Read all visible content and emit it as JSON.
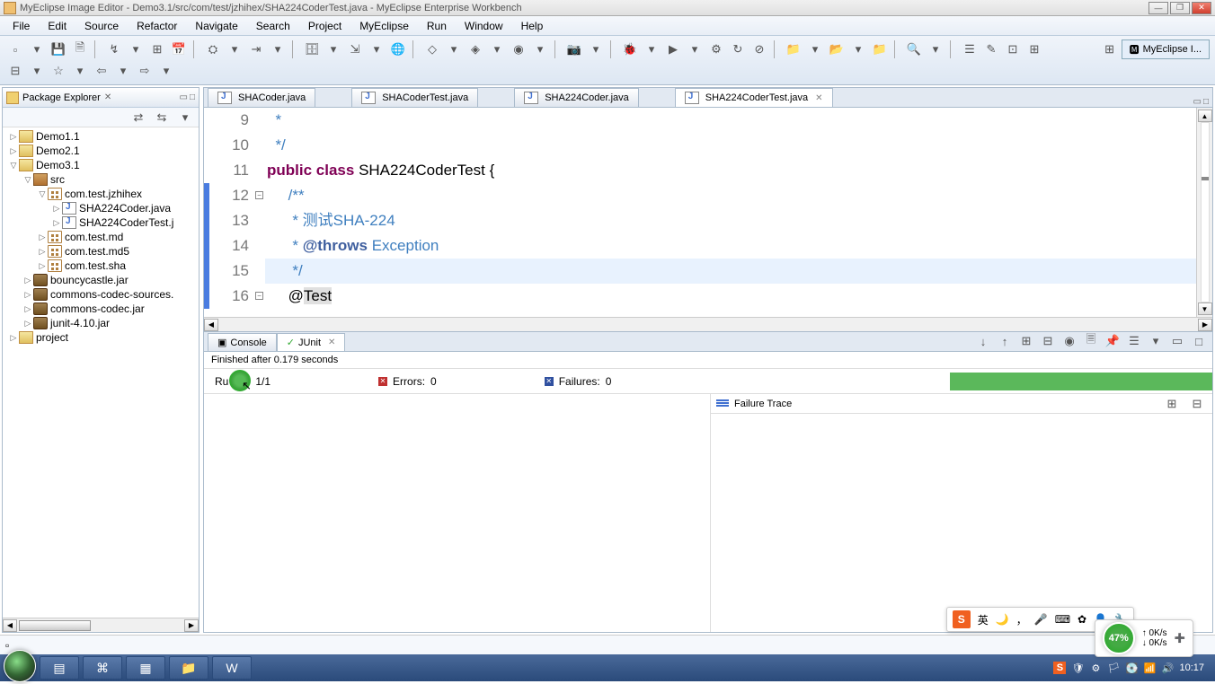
{
  "title": "MyEclipse Image Editor - Demo3.1/src/com/test/jzhihex/SHA224CoderTest.java - MyEclipse Enterprise Workbench",
  "menu": [
    "File",
    "Edit",
    "Source",
    "Refactor",
    "Navigate",
    "Search",
    "Project",
    "MyEclipse",
    "Run",
    "Window",
    "Help"
  ],
  "perspective_label": "MyEclipse I...",
  "pkg_explorer": {
    "title": "Package Explorer",
    "tree": [
      {
        "d": 0,
        "exp": "▷",
        "icon": "i-proj",
        "label": "Demo1.1"
      },
      {
        "d": 0,
        "exp": "▷",
        "icon": "i-proj",
        "label": "Demo2.1"
      },
      {
        "d": 0,
        "exp": "▽",
        "icon": "i-proj",
        "label": "Demo3.1"
      },
      {
        "d": 1,
        "exp": "▽",
        "icon": "i-src",
        "label": "src"
      },
      {
        "d": 2,
        "exp": "▽",
        "icon": "i-pkg",
        "label": "com.test.jzhihex"
      },
      {
        "d": 3,
        "exp": "▷",
        "icon": "i-java",
        "label": "SHA224Coder.java"
      },
      {
        "d": 3,
        "exp": "▷",
        "icon": "i-java",
        "label": "SHA224CoderTest.j"
      },
      {
        "d": 2,
        "exp": "▷",
        "icon": "i-pkg",
        "label": "com.test.md"
      },
      {
        "d": 2,
        "exp": "▷",
        "icon": "i-pkg",
        "label": "com.test.md5"
      },
      {
        "d": 2,
        "exp": "▷",
        "icon": "i-pkg",
        "label": "com.test.sha"
      },
      {
        "d": 1,
        "exp": "▷",
        "icon": "i-jar",
        "label": "bouncycastle.jar"
      },
      {
        "d": 1,
        "exp": "▷",
        "icon": "i-jar",
        "label": "commons-codec-sources."
      },
      {
        "d": 1,
        "exp": "▷",
        "icon": "i-jar",
        "label": "commons-codec.jar"
      },
      {
        "d": 1,
        "exp": "▷",
        "icon": "i-jar",
        "label": "junit-4.10.jar"
      },
      {
        "d": 0,
        "exp": "▷",
        "icon": "i-folder",
        "label": "project"
      }
    ]
  },
  "editor": {
    "tabs": [
      {
        "label": "SHACoder.java",
        "active": false
      },
      {
        "label": "SHACoderTest.java",
        "active": false
      },
      {
        "label": "SHA224Coder.java",
        "active": false
      },
      {
        "label": "SHA224CoderTest.java",
        "active": true
      }
    ],
    "lines": [
      {
        "n": 9,
        "t": "cm",
        "text": "  *"
      },
      {
        "n": 10,
        "t": "cm",
        "text": "  */"
      },
      {
        "n": 11,
        "t": "code",
        "segments": [
          {
            "t": "kw",
            "s": "public"
          },
          {
            "t": "",
            "s": " "
          },
          {
            "t": "kw",
            "s": "class"
          },
          {
            "t": "",
            "s": " SHA224CoderTest {"
          }
        ]
      },
      {
        "n": 12,
        "t": "cm",
        "text": "     /**",
        "fold": "-"
      },
      {
        "n": 13,
        "t": "cm",
        "text": "      * 测试SHA-224"
      },
      {
        "n": 14,
        "t": "cm",
        "segments": [
          {
            "t": "cm",
            "s": "      * "
          },
          {
            "t": "cmtag",
            "s": "@throws"
          },
          {
            "t": "cm",
            "s": " Exception"
          }
        ]
      },
      {
        "n": 15,
        "t": "cm",
        "text": "      */",
        "highlight": true
      },
      {
        "n": 16,
        "t": "code",
        "segments": [
          {
            "t": "",
            "s": "     @"
          },
          {
            "t": "anno",
            "s": "Test"
          }
        ],
        "fold": "-"
      }
    ]
  },
  "bottom": {
    "tabs": [
      {
        "label": "Console"
      },
      {
        "label": "JUnit",
        "active": true
      }
    ],
    "status": "Finished after 0.179 seconds",
    "runs_label": "Ru",
    "runs_value": "1/1",
    "errors_label": "Errors:",
    "errors_value": "0",
    "failures_label": "Failures:",
    "failures_value": "0",
    "trace_title": "Failure Trace"
  },
  "ime": {
    "lang": "英"
  },
  "net": {
    "pct": "47%",
    "up": "0K/s",
    "down": "0K/s"
  },
  "clock": "10:17"
}
